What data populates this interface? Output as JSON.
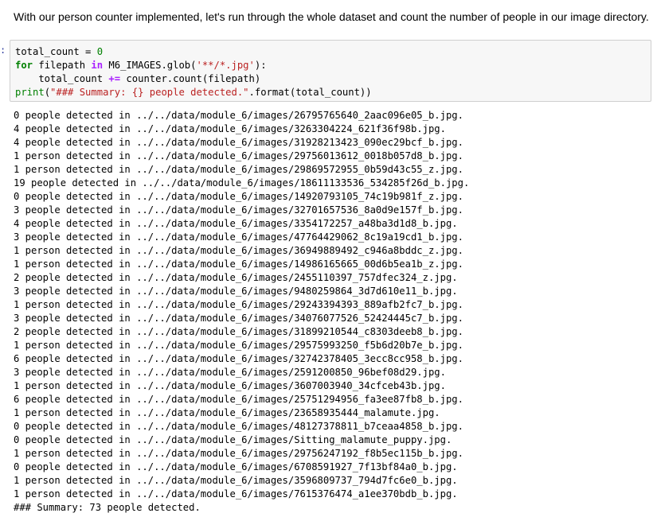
{
  "markdown": {
    "text": "With our person counter implemented, let's run through the whole dataset and count the number of people in our image directory."
  },
  "cell": {
    "prompt_marker": ":",
    "code": {
      "line1": {
        "var": "total_count",
        "op": " = ",
        "num": "0"
      },
      "line2": {
        "kw_for": "for",
        "var": " filepath ",
        "kw_in": "in",
        "rest": " M6_IMAGES.glob(",
        "str": "'**/*.jpg'",
        "end": "):"
      },
      "line3": {
        "indent": "    total_count ",
        "op": "+=",
        "rest": " counter.count(filepath)"
      },
      "line4": {
        "fn": "print",
        "open": "(",
        "str": "\"### Summary: {} people detected.\"",
        "rest": ".format(total_count))"
      }
    }
  },
  "output_lines": [
    "0 people detected in ../../data/module_6/images/26795765640_2aac096e05_b.jpg.",
    "4 people detected in ../../data/module_6/images/3263304224_621f36f98b.jpg.",
    "4 people detected in ../../data/module_6/images/31928213423_090ec29bcf_b.jpg.",
    "1 person detected in ../../data/module_6/images/29756013612_0018b057d8_b.jpg.",
    "1 person detected in ../../data/module_6/images/29869572955_0b59d43c55_z.jpg.",
    "19 people detected in ../../data/module_6/images/18611133536_534285f26d_b.jpg.",
    "0 people detected in ../../data/module_6/images/14920793105_74c19b981f_z.jpg.",
    "3 people detected in ../../data/module_6/images/32701657536_8a0d9e157f_b.jpg.",
    "4 people detected in ../../data/module_6/images/3354172257_a48ba3d1d8_b.jpg.",
    "3 people detected in ../../data/module_6/images/47764429062_8c19a19cd1_b.jpg.",
    "1 person detected in ../../data/module_6/images/36949889492_c946a8bddc_z.jpg.",
    "1 person detected in ../../data/module_6/images/14986165665_00d6b5ea1b_z.jpg.",
    "2 people detected in ../../data/module_6/images/2455110397_757dfec324_z.jpg.",
    "3 people detected in ../../data/module_6/images/9480259864_3d7d610e11_b.jpg.",
    "1 person detected in ../../data/module_6/images/29243394393_889afb2fc7_b.jpg.",
    "3 people detected in ../../data/module_6/images/34076077526_52424445c7_b.jpg.",
    "2 people detected in ../../data/module_6/images/31899210544_c8303deeb8_b.jpg.",
    "1 person detected in ../../data/module_6/images/29575993250_f5b6d20b7e_b.jpg.",
    "6 people detected in ../../data/module_6/images/32742378405_3ecc8cc958_b.jpg.",
    "3 people detected in ../../data/module_6/images/2591200850_96bef08d29.jpg.",
    "1 person detected in ../../data/module_6/images/3607003940_34cfceb43b.jpg.",
    "6 people detected in ../../data/module_6/images/25751294956_fa3ee87fb8_b.jpg.",
    "1 person detected in ../../data/module_6/images/23658935444_malamute.jpg.",
    "0 people detected in ../../data/module_6/images/48127378811_b7ceaa4858_b.jpg.",
    "0 people detected in ../../data/module_6/images/Sitting_malamute_puppy.jpg.",
    "1 person detected in ../../data/module_6/images/29756247192_f8b5ec115b_b.jpg.",
    "0 people detected in ../../data/module_6/images/6708591927_7f13bf84a0_b.jpg.",
    "1 person detected in ../../data/module_6/images/3596809737_794d7fc6e0_b.jpg.",
    "1 person detected in ../../data/module_6/images/7615376474_a1ee370bdb_b.jpg.",
    "### Summary: 73 people detected."
  ]
}
